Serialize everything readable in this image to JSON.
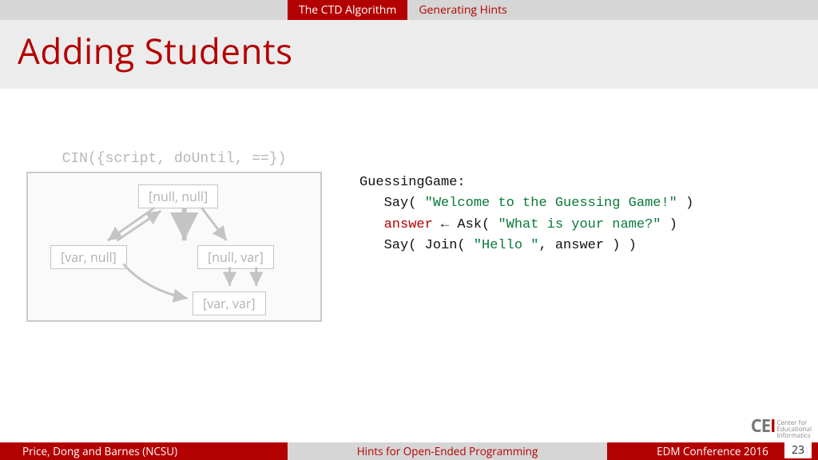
{
  "nav": {
    "active_tab": "The CTD Algorithm",
    "inactive_tab": "Generating Hints"
  },
  "title": "Adding Students",
  "diagram": {
    "caption": "CIN({script, doUntil, ==})",
    "nodes": {
      "top": "[null, null]",
      "left": "[var, null]",
      "right": "[null, var]",
      "bottom": "[var, var]"
    }
  },
  "code": {
    "header": "GuessingGame:",
    "l1_a": "Say( ",
    "l1_str": "\"Welcome to the Guessing Game!\"",
    "l1_b": " )",
    "l2_kw": "answer",
    "l2_a": " ← Ask( ",
    "l2_str": "\"What is your name?\"",
    "l2_b": " )",
    "l3_a": "Say( Join( ",
    "l3_str": "\"Hello \"",
    "l3_b": ", answer ) )"
  },
  "footer": {
    "authors": "Price, Dong and Barnes (NCSU)",
    "center": "Hints for Open-Ended Programming",
    "venue": "EDM Conference 2016",
    "page": "23"
  },
  "logo": {
    "letters_a": "CE",
    "letters_b": "I",
    "line1": "Center for",
    "line2": "Educational",
    "line3": "Informatics"
  }
}
